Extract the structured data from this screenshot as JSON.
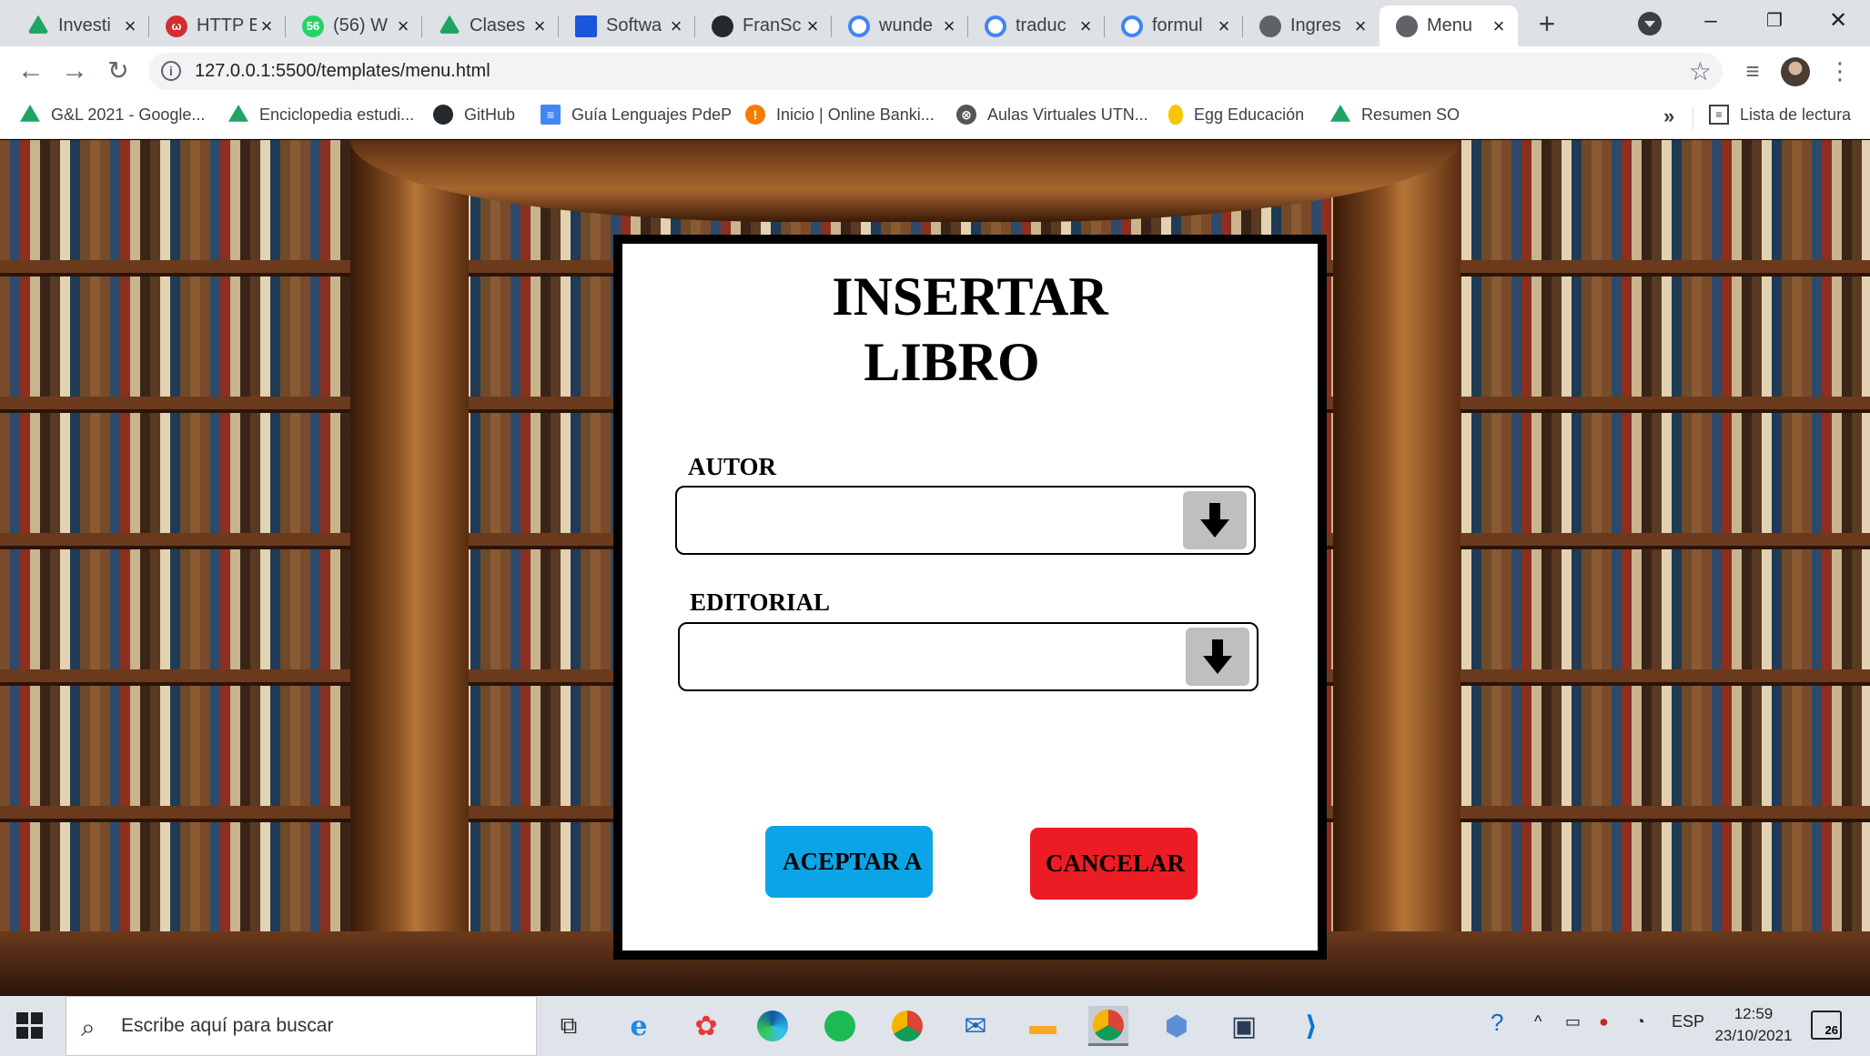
{
  "browser": {
    "tabs": [
      {
        "title": "Investi",
        "icon": "google-drive-icon",
        "color": "#1fa463"
      },
      {
        "title": "HTTP E",
        "icon": "w-icon",
        "color": "#d32f2f"
      },
      {
        "title": "(56) W",
        "icon": "whatsapp-icon",
        "color": "#25d366"
      },
      {
        "title": "Clases",
        "icon": "google-drive-icon",
        "color": "#1fa463"
      },
      {
        "title": "Softwa",
        "icon": "blue-square-icon",
        "color": "#1a56db"
      },
      {
        "title": "FranSc",
        "icon": "github-icon",
        "color": "#24292e"
      },
      {
        "title": "wunde",
        "icon": "google-icon",
        "color": "#4285f4"
      },
      {
        "title": "traduc",
        "icon": "google-icon",
        "color": "#4285f4"
      },
      {
        "title": "formul",
        "icon": "google-icon",
        "color": "#4285f4"
      },
      {
        "title": "Ingres",
        "icon": "globe-icon",
        "color": "#5f6368"
      },
      {
        "title": "Menu",
        "icon": "globe-icon",
        "color": "#5f6368",
        "active": true
      }
    ],
    "url": "127.0.0.1:5500/templates/menu.html",
    "bookmarks": [
      {
        "label": "G&L 2021 - Google...",
        "icon": "google-drive-icon",
        "color": "#1fa463"
      },
      {
        "label": "Enciclopedia estudi...",
        "icon": "google-drive-icon",
        "color": "#1fa463"
      },
      {
        "label": "GitHub",
        "icon": "github-icon",
        "color": "#24292e"
      },
      {
        "label": "Guía Lenguajes PdeP",
        "icon": "google-docs-icon",
        "color": "#4285f4"
      },
      {
        "label": "Inicio | Online Banki...",
        "icon": "bank-icon",
        "color": "#f57c00"
      },
      {
        "label": "Aulas Virtuales UTN...",
        "icon": "utn-icon",
        "color": "#555555"
      },
      {
        "label": "Egg Educación",
        "icon": "egg-icon",
        "color": "#f7c600"
      },
      {
        "label": "Resumen SO",
        "icon": "google-drive-icon",
        "color": "#1fa463"
      }
    ],
    "reading_list": "Lista de lectura",
    "more_bookmarks": "»"
  },
  "form": {
    "title_line1": "INSERTAR",
    "title_line2": "LIBRO",
    "autor_label": "AUTOR",
    "editorial_label": "EDITORIAL",
    "autor_value": "",
    "editorial_value": "",
    "accept_label": "ACEPTAR A",
    "cancel_label": "CANCELAR",
    "accept_color": "#0ba4e6",
    "cancel_color": "#ec1c24"
  },
  "taskbar": {
    "search_placeholder": "Escribe aquí para buscar",
    "language": "ESP",
    "time": "12:59",
    "date": "23/10/2021",
    "notifications": "26"
  }
}
